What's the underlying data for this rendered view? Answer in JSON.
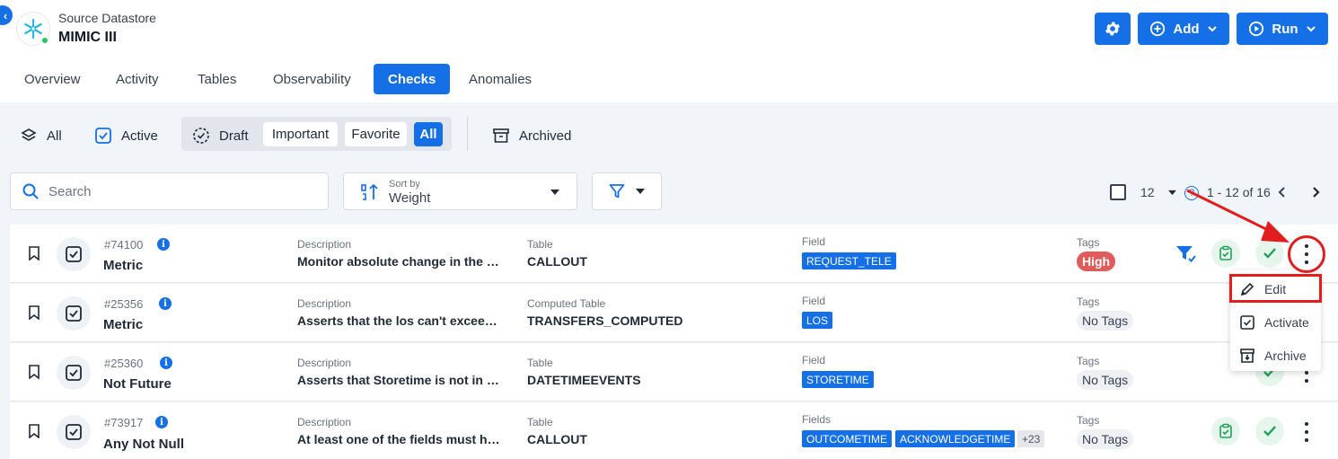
{
  "header": {
    "datastore_label": "Source Datastore",
    "datastore_name": "MIMIC III",
    "add_label": "Add",
    "run_label": "Run"
  },
  "tabs": [
    "Overview",
    "Activity",
    "Tables",
    "Observability",
    "Checks",
    "Anomalies"
  ],
  "active_tab": "Checks",
  "filters": {
    "all": "All",
    "active": "Active",
    "draft": "Draft",
    "important": "Important",
    "favorite": "Favorite",
    "all_sub": "All",
    "archived": "Archived"
  },
  "search": {
    "placeholder": "Search"
  },
  "sort": {
    "caption": "Sort by",
    "value": "Weight"
  },
  "pager": {
    "per_page": "12",
    "range": "1 - 12 of 16"
  },
  "rows": [
    {
      "id": "#74100",
      "name": "Metric",
      "desc_label": "Description",
      "desc": "Monitor absolute change in the metric",
      "table_label": "Table",
      "table": "CALLOUT",
      "field_label": "Field",
      "fields": [
        "REQUEST_TELE"
      ],
      "more": "",
      "tags_label": "Tags",
      "tag": "High"
    },
    {
      "id": "#25356",
      "name": "Metric",
      "desc_label": "Description",
      "desc": "Asserts that the los can't exceed the threshold",
      "table_label": "Computed Table",
      "table": "TRANSFERS_COMPUTED",
      "field_label": "Field",
      "fields": [
        "LOS"
      ],
      "more": "",
      "tags_label": "Tags",
      "tag": "No Tags"
    },
    {
      "id": "#25360",
      "name": "Not Future",
      "desc_label": "Description",
      "desc": "Asserts that Storetime is not in future",
      "table_label": "Table",
      "table": "DATETIMEEVENTS",
      "field_label": "Field",
      "fields": [
        "STORETIME"
      ],
      "more": "",
      "tags_label": "Tags",
      "tag": "No Tags"
    },
    {
      "id": "#73917",
      "name": "Any Not Null",
      "desc_label": "Description",
      "desc": "At least one of the fields must hold a value",
      "table_label": "Table",
      "table": "CALLOUT",
      "field_label": "Fields",
      "fields": [
        "OUTCOMETIME",
        "ACKNOWLEDGETIME"
      ],
      "more": "+23",
      "tags_label": "Tags",
      "tag": "No Tags"
    }
  ],
  "menu": {
    "edit": "Edit",
    "activate": "Activate",
    "archive": "Archive"
  },
  "colors": {
    "primary": "#1570e8",
    "high_tag": "#e05b5b",
    "annotation": "#e11d1d",
    "success": "#22c55e"
  }
}
